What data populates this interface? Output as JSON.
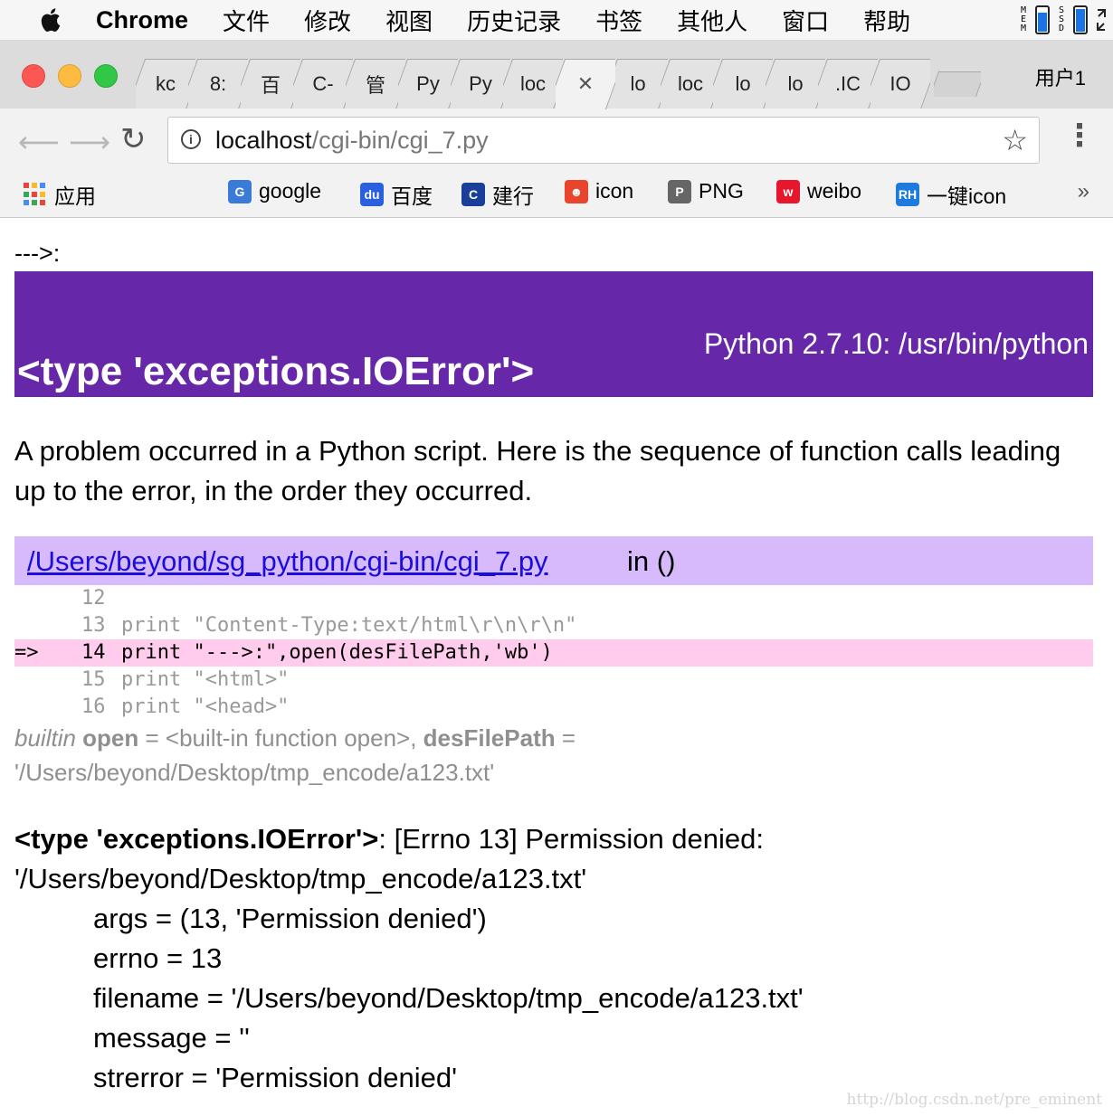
{
  "menubar": {
    "app_name": "Chrome",
    "items": [
      "文件",
      "修改",
      "视图",
      "历史记录",
      "书签",
      "其他人",
      "窗口",
      "帮助"
    ],
    "status": {
      "mem_label": "MEM",
      "ssd_label": "SSD",
      "mem_level": 0.75,
      "ssd_level": 0.9
    }
  },
  "tabs": {
    "items": [
      "kc",
      "8:",
      "百",
      "C-",
      "管",
      "Py",
      "Py",
      "loc",
      "",
      "lo",
      "loc",
      "lo",
      "lo",
      ".IC",
      "IO"
    ],
    "active_index": 8,
    "close_symbol": "✕",
    "user_label": "用户1"
  },
  "toolbar": {
    "url_host": "localhost",
    "url_path": "/cgi-bin/cgi_7.py"
  },
  "bookmarks": {
    "apps_label": "应用",
    "items": [
      {
        "label": "google",
        "icon": "paw-icon",
        "color": "#3b7bd8",
        "glyph": "G"
      },
      {
        "label": "百度",
        "icon": "baidu-paw-icon",
        "color": "#2a5fe0",
        "glyph": "du"
      },
      {
        "label": "建行",
        "icon": "ccb-icon",
        "color": "#1a3f9a",
        "glyph": "C"
      },
      {
        "label": "icon",
        "icon": "iconfont-icon",
        "color": "#e8452c",
        "glyph": "☻"
      },
      {
        "label": "PNG",
        "icon": "panda-icon",
        "color": "#666666",
        "glyph": "P"
      },
      {
        "label": "weibo",
        "icon": "weibo-icon",
        "color": "#e6162d",
        "glyph": "w"
      },
      {
        "label": "一键icon",
        "icon": "rh-icon",
        "color": "#1d7be0",
        "glyph": "RH"
      }
    ],
    "more": "»"
  },
  "page": {
    "prefix": "--->:",
    "banner": {
      "title": "<type 'exceptions.IOError'>",
      "python": "Python 2.7.10: /usr/bin/python"
    },
    "intro": "A problem occurred in a Python script. Here is the sequence of function calls leading up to the error, in the order they occurred.",
    "frame": {
      "link": "/Users/beyond/sg_python/cgi-bin/cgi_7.py",
      "in_fn": "in ()"
    },
    "code_lines": [
      {
        "num": "12",
        "text": "",
        "highlight": false
      },
      {
        "num": "13",
        "text": "print \"Content-Type:text/html\\r\\n\\r\\n\"",
        "highlight": false
      },
      {
        "num": "14",
        "text": "print \"--->:\",open(desFilePath,'wb')",
        "highlight": true
      },
      {
        "num": "15",
        "text": "print \"<html>\"",
        "highlight": false
      },
      {
        "num": "16",
        "text": "print \"<head>\"",
        "highlight": false
      }
    ],
    "arrow": "=>",
    "vars": {
      "builtin_word": "builtin",
      "open_name": "open",
      "open_value": " = <built-in function open>, ",
      "desfile_name": "desFilePath",
      "desfile_value": " =",
      "desfile_path": "'/Users/beyond/Desktop/tmp_encode/a123.txt'"
    },
    "exception": {
      "type": "<type 'exceptions.IOError'>",
      "message": ": [Errno 13] Permission denied:",
      "path": "'/Users/beyond/Desktop/tmp_encode/a123.txt'",
      "attrs": [
        "args = (13, 'Permission denied')",
        "errno = 13",
        "filename = '/Users/beyond/Desktop/tmp_encode/a123.txt'",
        "message = ''",
        "strerror = 'Permission denied'"
      ]
    },
    "watermark": "http://blog.csdn.net/pre_eminent"
  }
}
